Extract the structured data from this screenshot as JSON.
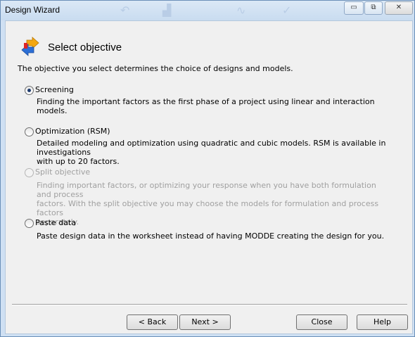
{
  "window": {
    "title": "Design Wizard",
    "minimize_glyph": "▭",
    "restore_glyph": "⧉",
    "close_glyph": "✕"
  },
  "header": {
    "title": "Select objective",
    "icon": "swap-arrows-icon"
  },
  "intro": "The objective you select determines the choice of designs and models.",
  "options": [
    {
      "label": "Screening",
      "description": "Finding the important factors as the first phase of a project using linear and interaction models.",
      "selected": true,
      "enabled": true
    },
    {
      "label": "Optimization (RSM)",
      "description_lines": [
        "Detailed modeling and optimization using quadratic and cubic models. RSM is available in investigations",
        "with up to 20 factors."
      ],
      "selected": false,
      "enabled": true
    },
    {
      "label": "Split objective",
      "description_lines": [
        "Finding important factors, or optimizing your response when you have both formulation and process",
        "factors. With the split objective you may choose the models for formulation and process factors",
        "separately."
      ],
      "selected": false,
      "enabled": false
    },
    {
      "label": "Paste data",
      "description": "Paste design data in the worksheet instead of having MODDE creating the design for you.",
      "selected": false,
      "enabled": true
    }
  ],
  "buttons": {
    "back": "< Back",
    "next": "Next >",
    "close": "Close",
    "help": "Help"
  },
  "colors": {
    "frame": "#cfe0f3",
    "client": "#f0f0f0",
    "disabled_text": "#a0a0a0"
  }
}
